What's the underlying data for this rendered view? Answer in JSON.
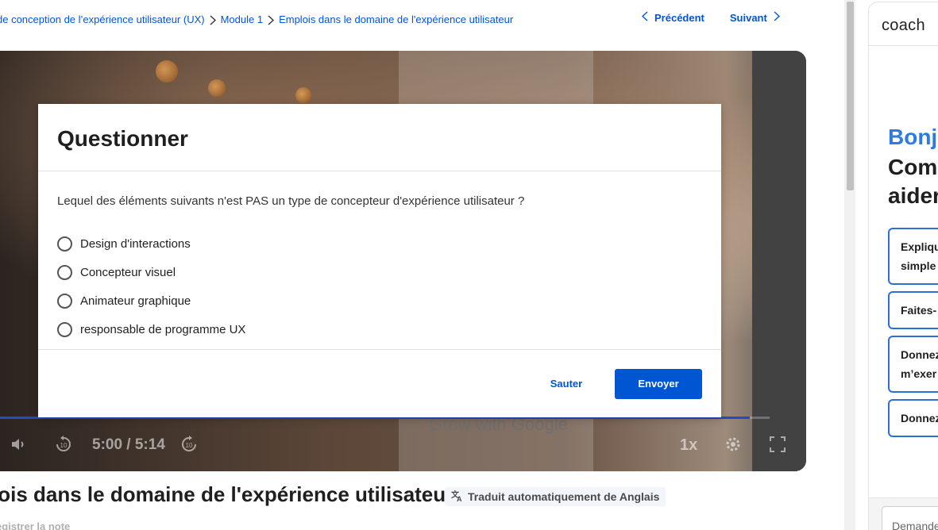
{
  "breadcrumb": {
    "items": [
      "de conception de l’expérience utilisateur (UX)",
      "Module 1",
      "Emplois dans le domaine de l'expérience utilisateur"
    ]
  },
  "pager": {
    "prev_label": "Précédent",
    "next_label": "Suivant"
  },
  "video": {
    "time": "5:00 / 5:14",
    "speed": "1x",
    "watermark": "Grow with Google",
    "progress": 0.974
  },
  "quiz": {
    "title": "Questionner",
    "question": "Lequel des éléments suivants n'est PAS un type de concepteur d'expérience utilisateur ?",
    "options": [
      "Design d'interactions",
      "Concepteur visuel",
      "Animateur graphique",
      "responsable de programme UX"
    ],
    "skip_label": "Sauter",
    "submit_label": "Envoyer"
  },
  "lesson": {
    "title": "lois dans le domaine de l'expérience utilisateur",
    "translation_badge": "Traduit automatiquement de Anglais",
    "save_note": "registrer la note"
  },
  "coach": {
    "title": "coach",
    "greeting": "Bonjo",
    "help_line1": "Comm",
    "help_line2": "aider",
    "suggestions": [
      "Expliqu",
      "simple",
      "Faites-",
      "Donnez",
      "m’exer",
      "Donnez"
    ],
    "input_placeholder": "Demande"
  },
  "colors": {
    "accent": "#0056d2",
    "coach_blue": "#2d7ae0"
  }
}
